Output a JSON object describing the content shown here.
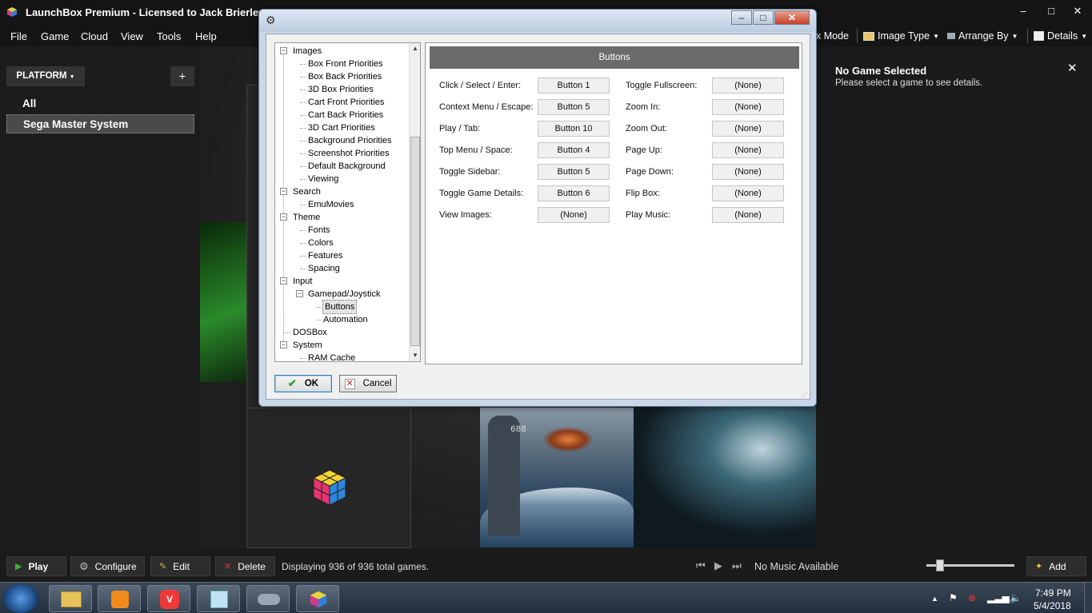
{
  "window": {
    "title": "LaunchBox Premium - Licensed to Jack Brierley",
    "controls": {
      "minimize": "–",
      "maximize": "□",
      "close": "✕"
    }
  },
  "menu": [
    "File",
    "Game",
    "Cloud",
    "View",
    "Tools",
    "Help"
  ],
  "toolbar": {
    "mode_label": "x Mode",
    "image_type_label": "Image Type",
    "arrange_by_label": "Arrange By",
    "details_label": "Details"
  },
  "sidebar": {
    "filter_label": "PLATFORM",
    "add_label": "+",
    "items": [
      {
        "label": "All",
        "selected": false
      },
      {
        "label": "Sega Master System",
        "selected": true
      }
    ]
  },
  "cover": {
    "hull_number": "688"
  },
  "details": {
    "title": "No Game Selected",
    "subtitle": "Please select a game to see details.",
    "close": "✕"
  },
  "bottom_bar": {
    "play_label": "Play",
    "configure_label": "Configure",
    "edit_label": "Edit",
    "delete_label": "Delete",
    "status": "Displaying 936 of 936 total games.",
    "music": "No Music Available",
    "volume": 0.15,
    "add_label": "Add"
  },
  "dialog": {
    "tree": [
      {
        "label": "Images",
        "level": 0,
        "expander": "−"
      },
      {
        "label": "Box Front Priorities",
        "level": 1
      },
      {
        "label": "Box Back Priorities",
        "level": 1
      },
      {
        "label": "3D Box Priorities",
        "level": 1
      },
      {
        "label": "Cart Front Priorities",
        "level": 1
      },
      {
        "label": "Cart Back Priorities",
        "level": 1
      },
      {
        "label": "3D Cart Priorities",
        "level": 1
      },
      {
        "label": "Background Priorities",
        "level": 1
      },
      {
        "label": "Screenshot Priorities",
        "level": 1
      },
      {
        "label": "Default Background",
        "level": 1
      },
      {
        "label": "Viewing",
        "level": 1
      },
      {
        "label": "Search",
        "level": 0,
        "expander": "−"
      },
      {
        "label": "EmuMovies",
        "level": 1
      },
      {
        "label": "Theme",
        "level": 0,
        "expander": "−"
      },
      {
        "label": "Fonts",
        "level": 1
      },
      {
        "label": "Colors",
        "level": 1
      },
      {
        "label": "Features",
        "level": 1
      },
      {
        "label": "Spacing",
        "level": 1
      },
      {
        "label": "Input",
        "level": 0,
        "expander": "−"
      },
      {
        "label": "Gamepad/Joystick",
        "level": 1,
        "expander": "−"
      },
      {
        "label": "Buttons",
        "level": 2,
        "selected": true
      },
      {
        "label": "Automation",
        "level": 2
      },
      {
        "label": "DOSBox",
        "level": 0
      },
      {
        "label": "System",
        "level": 0,
        "expander": "−"
      },
      {
        "label": "RAM Cache",
        "level": 1
      }
    ],
    "panel_title": "Buttons",
    "left_mappings": [
      {
        "label": "Click / Select / Enter:",
        "value": "Button 1"
      },
      {
        "label": "Context Menu / Escape:",
        "value": "Button 5"
      },
      {
        "label": "Play / Tab:",
        "value": "Button 10"
      },
      {
        "label": "Top Menu / Space:",
        "value": "Button 4"
      },
      {
        "label": "Toggle Sidebar:",
        "value": "Button 5"
      },
      {
        "label": "Toggle Game Details:",
        "value": "Button 6"
      },
      {
        "label": "View Images:",
        "value": "(None)"
      }
    ],
    "right_mappings": [
      {
        "label": "Toggle Fullscreen:",
        "value": "(None)"
      },
      {
        "label": "Zoom In:",
        "value": "(None)"
      },
      {
        "label": "Zoom Out:",
        "value": "(None)"
      },
      {
        "label": "Page Up:",
        "value": "(None)"
      },
      {
        "label": "Page Down:",
        "value": "(None)"
      },
      {
        "label": "Flip Box:",
        "value": "(None)"
      },
      {
        "label": "Play Music:",
        "value": "(None)"
      }
    ],
    "ok_label": "OK",
    "cancel_label": "Cancel"
  },
  "taskbar": {
    "time": "7:49 PM",
    "date": "5/4/2018"
  },
  "colors": {
    "app_bg": "#1b1b1b",
    "dialog_frame": "#c8d6e6",
    "panel_header": "#6b6b6b",
    "ok_check": "#2e9e2e",
    "cancel_x": "#d02020"
  }
}
